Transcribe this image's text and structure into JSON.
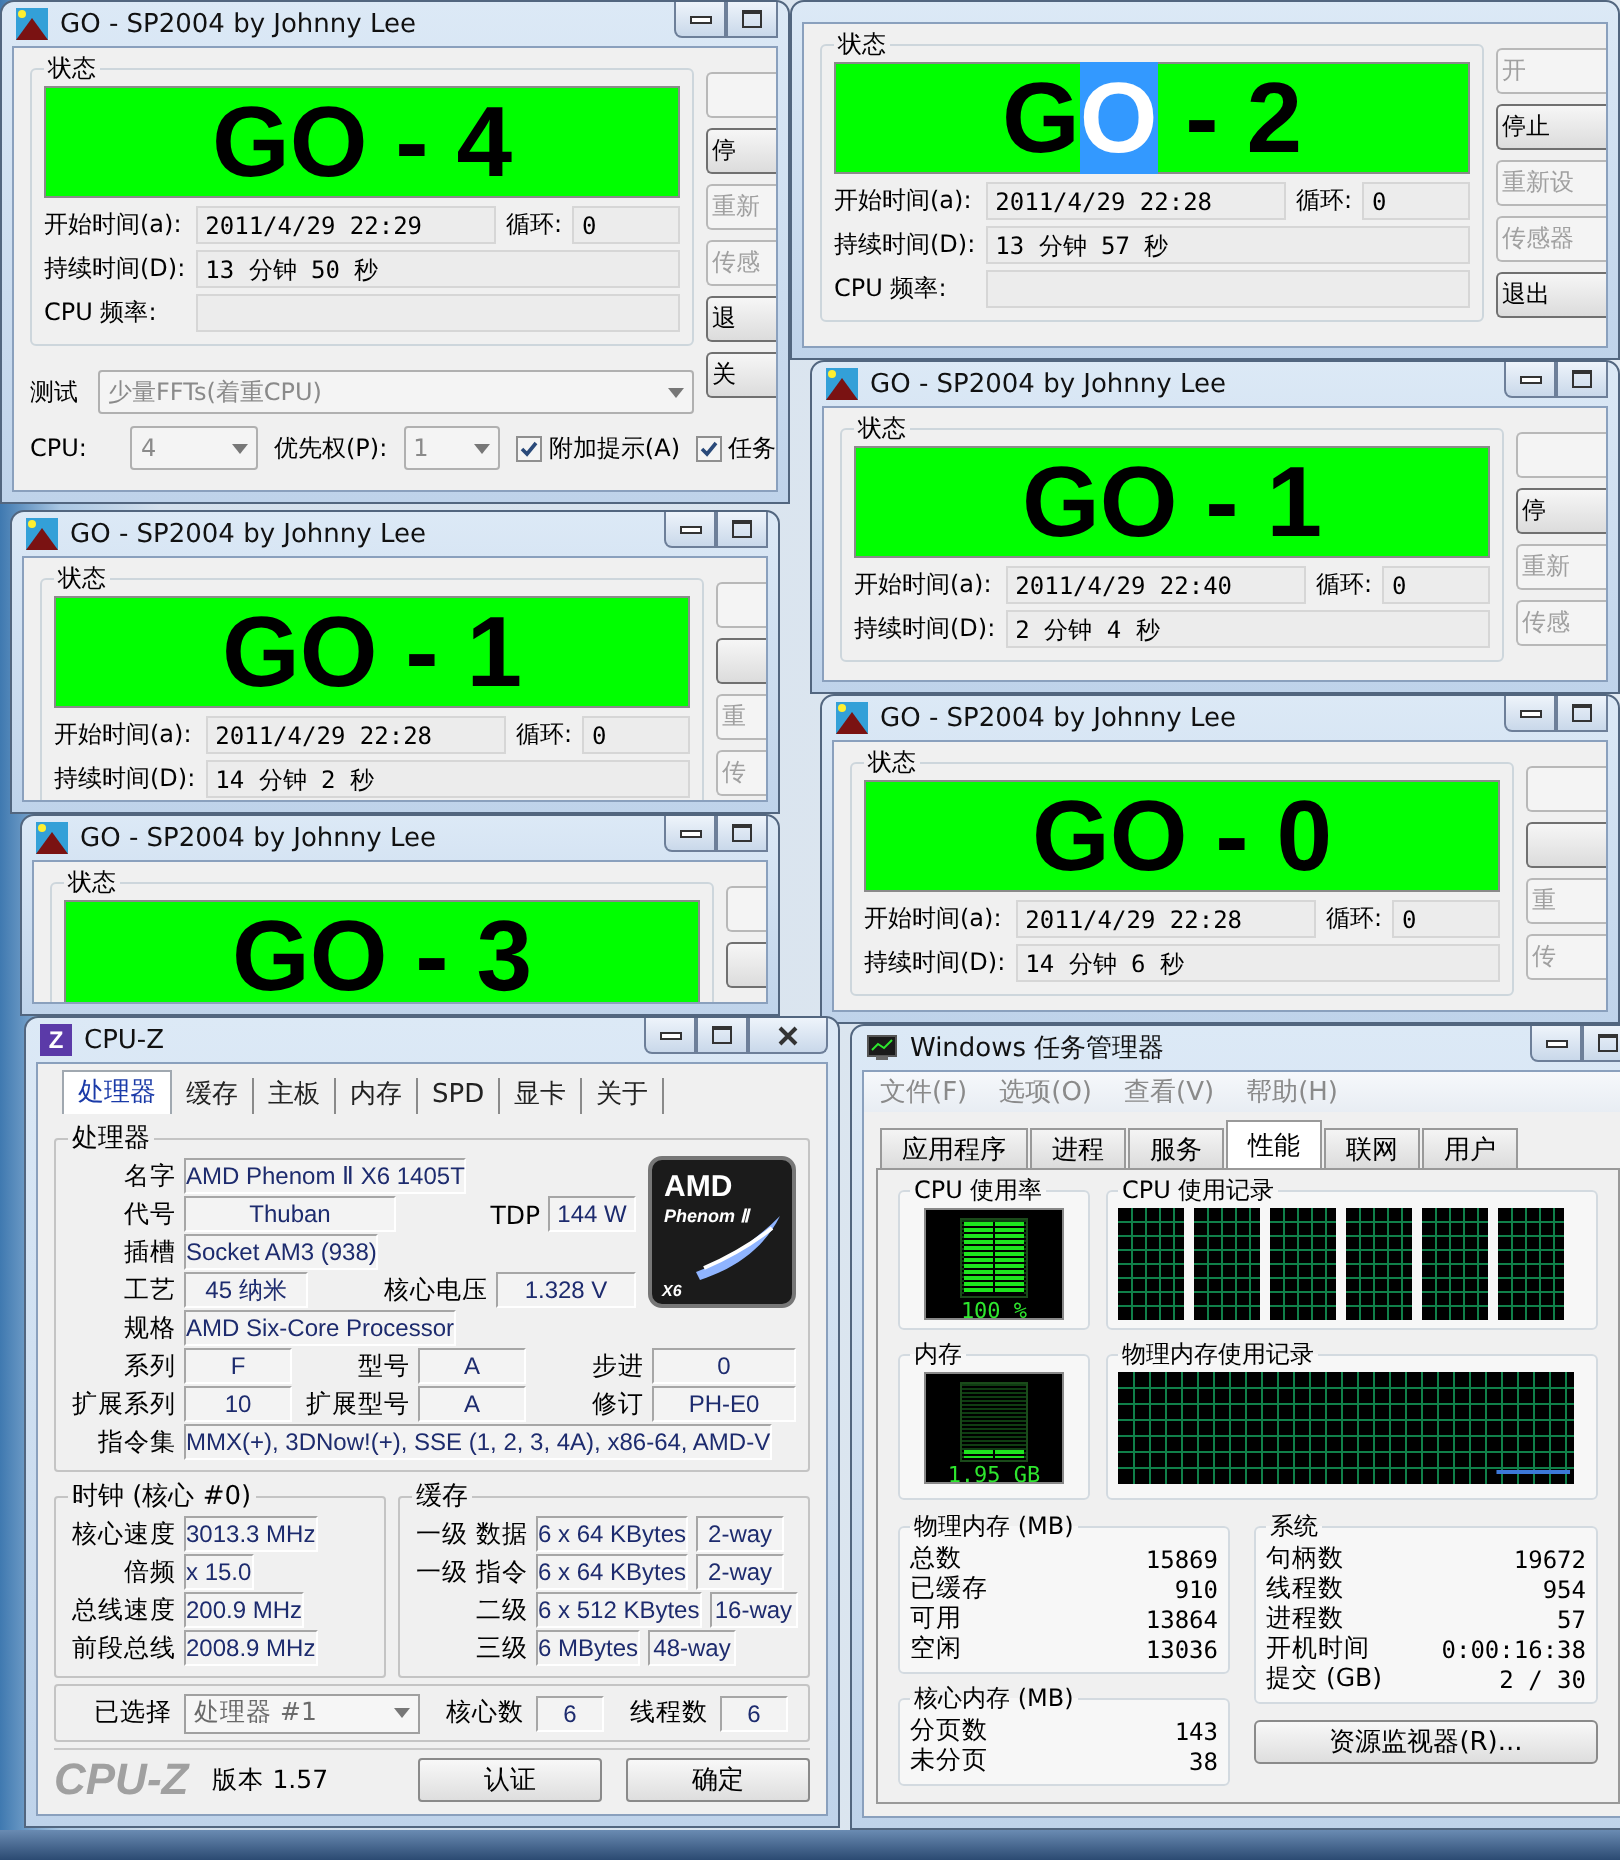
{
  "sp2004_windows": [
    {
      "title": "GO - SP2004 by Johnny Lee",
      "status_label": "状态",
      "status": [
        {
          "text": "GO - 4",
          "selected": false
        }
      ],
      "start_label": "开始时间(a):",
      "start_time": "2011/4/29 22:29",
      "loop_label": "循环:",
      "loop": "0",
      "duration_label": "持续时间(D):",
      "duration": "13 分钟 50 秒",
      "cpu_freq_label": "CPU 频率:",
      "buttons": [
        {
          "disabled": true
        },
        {
          "label": "停",
          "disabled": false
        },
        {
          "label": "重新",
          "disabled": true
        },
        {
          "label": "传感",
          "disabled": true
        },
        {
          "label": "退",
          "disabled": false
        },
        {
          "label": "关",
          "disabled": false
        }
      ],
      "test": {
        "label": "测试",
        "value": "少量FFTs(着重CPU)"
      },
      "cpu": {
        "label": "CPU:",
        "value": "4"
      },
      "priority": {
        "label": "优先权(P):",
        "value": "1"
      },
      "checkboxes": [
        {
          "label": "附加提示(A)",
          "checked": true
        },
        {
          "label": "任务",
          "checked": true
        }
      ]
    },
    {
      "status_label": "状态",
      "status": [
        {
          "text": "G",
          "selected": false
        },
        {
          "text": "O",
          "selected": true
        },
        {
          "text": " - 2",
          "selected": false
        }
      ],
      "start_label": "开始时间(a):",
      "start_time": "2011/4/29 22:28",
      "loop_label": "循环:",
      "loop": "0",
      "duration_label": "持续时间(D):",
      "duration": "13 分钟 57 秒",
      "cpu_freq_label": "CPU 频率:",
      "buttons": [
        {
          "label": "开",
          "disabled": true
        },
        {
          "label": "停止",
          "disabled": false
        },
        {
          "label": "重新设",
          "disabled": true
        },
        {
          "label": "传感器",
          "disabled": true
        },
        {
          "label": "退出",
          "disabled": false
        }
      ]
    },
    {
      "title": "GO - SP2004 by Johnny Lee",
      "status_label": "状态",
      "status": [
        {
          "text": "GO - 1",
          "selected": false
        }
      ],
      "start_label": "开始时间(a):",
      "start_time": "2011/4/29 22:28",
      "loop_label": "循环:",
      "loop": "0",
      "duration_label": "持续时间(D):",
      "duration": "14 分钟 2 秒",
      "buttons": [
        {
          "disabled": true
        },
        {
          "disabled": false
        },
        {
          "label": "重",
          "disabled": true
        },
        {
          "label": "传",
          "disabled": true
        }
      ]
    },
    {
      "title": "GO - SP2004 by Johnny Lee",
      "status_label": "状态",
      "status": [
        {
          "text": "GO - 3",
          "selected": false
        }
      ],
      "buttons": [
        {
          "disabled": true
        },
        {
          "disabled": false
        }
      ]
    },
    {
      "title": "GO - SP2004 by Johnny Lee",
      "status_label": "状态",
      "status": [
        {
          "text": "GO - 1",
          "selected": false
        }
      ],
      "start_label": "开始时间(a):",
      "start_time": "2011/4/29 22:40",
      "loop_label": "循环:",
      "loop": "0",
      "duration_label": "持续时间(D):",
      "duration": "2 分钟 4 秒",
      "buttons": [
        {
          "disabled": true
        },
        {
          "label": "停",
          "disabled": false
        },
        {
          "label": "重新",
          "disabled": true
        },
        {
          "label": "传感",
          "disabled": true
        }
      ]
    },
    {
      "title": "GO - SP2004 by Johnny Lee",
      "status_label": "状态",
      "status": [
        {
          "text": "GO - 0",
          "selected": false
        }
      ],
      "start_label": "开始时间(a):",
      "start_time": "2011/4/29 22:28",
      "loop_label": "循环:",
      "loop": "0",
      "duration_label": "持续时间(D):",
      "duration": "14 分钟 6 秒",
      "buttons": [
        {
          "disabled": true
        },
        {
          "disabled": false
        },
        {
          "label": "重",
          "disabled": true
        },
        {
          "label": "传",
          "disabled": true
        }
      ]
    }
  ],
  "cpuz": {
    "app_icon": "Z",
    "title": "CPU-Z",
    "tabs": [
      {
        "label": "处理器",
        "selected": true
      },
      {
        "label": "缓存",
        "selected": false
      },
      {
        "label": "主板",
        "selected": false
      },
      {
        "label": "内存",
        "selected": false
      },
      {
        "label": "SPD",
        "selected": false
      },
      {
        "label": "显卡",
        "selected": false
      },
      {
        "label": "关于",
        "selected": false
      }
    ],
    "processor": {
      "group_label": "处理器",
      "name_label": "名字",
      "name": "AMD Phenom Ⅱ X6 1405T",
      "codename_label": "代号",
      "codename": "Thuban",
      "tdp_label": "TDP",
      "tdp": "144 W",
      "socket_label": "插槽",
      "socket": "Socket AM3 (938)",
      "process_label": "工艺",
      "process": "45 纳米",
      "voltage_label": "核心电压",
      "voltage": "1.328 V",
      "spec_label": "规格",
      "spec": "AMD Six-Core Processor",
      "family_label": "系列",
      "family": "F",
      "model_label": "型号",
      "model": "A",
      "stepping_label": "步进",
      "stepping": "0",
      "ext_family_label": "扩展系列",
      "ext_family": "10",
      "ext_model_label": "扩展型号",
      "ext_model": "A",
      "revision_label": "修订",
      "revision": "PH-E0",
      "instructions_label": "指令集",
      "instructions": "MMX(+), 3DNow!(+), SSE (1, 2, 3, 4A), x86-64, AMD-V"
    },
    "logo": {
      "brand": "AMD",
      "product": "Phenom Ⅱ",
      "badge": "X6"
    },
    "clocks": {
      "group_label": "时钟 (核心 #0)",
      "rows": [
        {
          "label": "核心速度",
          "value": "3013.3 MHz"
        },
        {
          "label": "倍频",
          "value": "x 15.0"
        },
        {
          "label": "总线速度",
          "value": "200.9 MHz"
        },
        {
          "label": "前段总线",
          "value": "2008.9 MHz"
        }
      ]
    },
    "cache": {
      "group_label": "缓存",
      "rows": [
        {
          "label": "一级 数据",
          "size": "6 x 64 KBytes",
          "assoc": "2-way"
        },
        {
          "label": "一级 指令",
          "size": "6 x 64 KBytes",
          "assoc": "2-way"
        },
        {
          "label": "二级",
          "size": "6 x 512 KBytes",
          "assoc": "16-way"
        },
        {
          "label": "三级",
          "size": "6 MBytes",
          "assoc": "48-way"
        }
      ]
    },
    "selection": {
      "label": "已选择",
      "value": "处理器 #1",
      "cores_label": "核心数",
      "cores": "6",
      "threads_label": "线程数",
      "threads": "6"
    },
    "footer": {
      "logo": "CPU-Z",
      "version": "版本 1.57",
      "buttons": [
        "认证",
        "确定"
      ]
    }
  },
  "task_manager": {
    "title": "Windows 任务管理器",
    "menu": [
      "文件(F)",
      "选项(O)",
      "查看(V)",
      "帮助(H)"
    ],
    "tabs": [
      {
        "label": "应用程序",
        "selected": false
      },
      {
        "label": "进程",
        "selected": false
      },
      {
        "label": "服务",
        "selected": false
      },
      {
        "label": "性能",
        "selected": true
      },
      {
        "label": "联网",
        "selected": false
      },
      {
        "label": "用户",
        "selected": false
      }
    ],
    "cpu_usage": {
      "label": "CPU 使用率",
      "level": 1,
      "reading": "100 %"
    },
    "cpu_history": {
      "label": "CPU 使用记录"
    },
    "memory": {
      "label": "内存",
      "level": 0.12,
      "reading": "1.95 GB"
    },
    "memory_history": {
      "label": "物理内存使用记录"
    },
    "physical_memory": {
      "label": "物理内存 (MB)",
      "rows": [
        {
          "label": "总数",
          "value": "15869"
        },
        {
          "label": "已缓存",
          "value": "910"
        },
        {
          "label": "可用",
          "value": "13864"
        },
        {
          "label": "空闲",
          "value": "13036"
        }
      ]
    },
    "kernel_memory": {
      "label": "核心内存 (MB)",
      "rows": [
        {
          "label": "分页数",
          "value": "143"
        },
        {
          "label": "未分页",
          "value": "38"
        }
      ]
    },
    "system": {
      "label": "系统",
      "rows": [
        {
          "label": "句柄数",
          "value": "19672"
        },
        {
          "label": "线程数",
          "value": "954"
        },
        {
          "label": "进程数",
          "value": "57"
        },
        {
          "label": "开机时间",
          "value": "0:00:16:38"
        },
        {
          "label": "提交 (GB)",
          "value": "2 / 30"
        }
      ]
    },
    "resource_monitor_button": "资源监视器(R)..."
  }
}
